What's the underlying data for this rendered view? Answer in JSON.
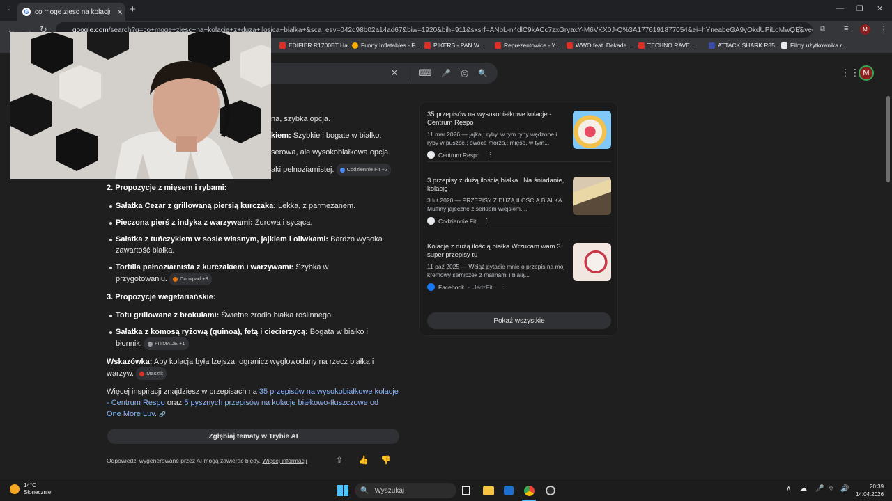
{
  "browser": {
    "tab_title": "co moge zjesc na kolacje z duż",
    "tab_close": "✕",
    "new_tab": "+",
    "url_host": "google.com",
    "url_rest": "/search?q=co+moge+zjesc+na+kolacje+z+duza+ilosica+bialka+&sca_esv=042d98b02a14ad67&biw=1920&bih=911&sxsrf=ANbL-n4dlC9kACc7zxGryaxY-M6VKX0J-Q%3A1776191877054&ei=hYneabeGA9yOkdUPiLqMwQE&ved=0ahU..."
  },
  "bookmarks": [
    {
      "label": "EDIFIER R1700BT Ha...",
      "color": "#d93025"
    },
    {
      "label": "Funny Inflatables - F...",
      "color": "#f9ab00"
    },
    {
      "label": "PIKERS - PAN W...",
      "color": "#d93025"
    },
    {
      "label": "Reprezentowice - Y...",
      "color": "#d93025"
    },
    {
      "label": "WWO feat. Dekade...",
      "color": "#d93025"
    },
    {
      "label": "TECHNO RAVE...",
      "color": "#d93025"
    },
    {
      "label": "ATTACK SHARK R85...",
      "color": "#3c4aa8"
    },
    {
      "label": "Filmy użytkownika r...",
      "color": "#e8eaed"
    }
  ],
  "overview": {
    "partial": [
      {
        "pre": "",
        "bold": "",
        "text": "na, szybka opcja."
      },
      {
        "pre": "",
        "bold": "kiem:",
        "text": " Szybkie i bogate w białko."
      },
      {
        "pre": "",
        "bold": "",
        "text": "serowa, ale wysokobiałkowa opcja."
      },
      {
        "pre": "",
        "bold": "",
        "text": "aki pełnoziarnistej."
      }
    ],
    "chip0": "Codziennie Fit +2",
    "section2": "2. Propozycje z mięsem i rybami:",
    "items2": [
      {
        "bold": "Sałatka Cezar z grillowaną piersią kurczaka:",
        "text": " Lekka, z parmezanem."
      },
      {
        "bold": "Pieczona pierś z indyka z warzywami:",
        "text": " Zdrowa i sycąca."
      },
      {
        "bold": "Sałatka z tuńczykiem w sosie własnym, jajkiem i oliwkami:",
        "text": " Bardzo wysoka",
        "line2": "zawartość białka."
      },
      {
        "bold": "Tortilla pełnoziarnista z kurczakiem i warzywami:",
        "text": " Szybka w",
        "line2": "przygotowaniu."
      }
    ],
    "chip1": "Cookpad +3",
    "section3": "3. Propozycje wegetariańskie:",
    "items3": [
      {
        "bold": "Tofu grillowane z brokułami:",
        "text": " Świetne źródło białka roślinnego."
      },
      {
        "bold": "Sałatka z komosą ryżową (quinoa), fetą i ciecierzycą:",
        "text": " Bogata w białko i",
        "line2": "błonnik."
      }
    ],
    "chip2": "FITMADE +1",
    "tip_bold": "Wskazówka:",
    "tip_text": " Aby kolacja była lżejsza, ogranicz węglowodany na rzecz białka i",
    "tip_line2": "warzyw.",
    "chip3": "Maczfit",
    "more_pre": "Więcej inspiracji znajdziesz w przepisach na ",
    "more_link1a": "35 przepisów na wysokobiałkowe kolacje",
    "more_link1b": "- Centrum Respo",
    "more_mid": " oraz ",
    "more_link2a": "5 pysznych przepisów na kolacje białkowo-tłuszczowe od",
    "more_link2b": "One More Luv",
    "more_end": ".",
    "dive_button": "Zgłębiaj tematy w Trybie AI",
    "disclaimer": "Odpowiedzi wygenerowane przez AI mogą zawierać błędy.",
    "disclaimer_link": "Więcej informacji"
  },
  "sources": [
    {
      "title": "35 przepisów na wysokobiałkowe kolacje - Centrum Respo",
      "snippet": "11 mar 2026 — jajka,; ryby, w tym ryby wędzone i ryby w puszce,; owoce morza,; mięso, w tym...",
      "site": "Centrum Respo",
      "site2": "",
      "icon_color": "#e8eaed"
    },
    {
      "title": "3 przepisy z dużą ilością białka | Na śniadanie, kolację",
      "snippet": "3 lut 2020 — PRZEPISY Z DUŻĄ ILOŚCIĄ BIAŁKA. Muffiny jajeczne z serkiem wiejskim....",
      "site": "Codziennie Fit",
      "site2": "",
      "icon_color": "#e8eaed"
    },
    {
      "title": "Kolacje z dużą ilością białka Wrzucam wam 3 super przepisy tu",
      "snippet": "11 paź 2025 — Wciąż pytacie mnie o przepis na mój kremowy serniczek z malinami i białą...",
      "site": "Facebook",
      "site2": "JedzFit",
      "icon_color": "#1877f2"
    }
  ],
  "show_all": "Pokaż wszystkie",
  "taskbar": {
    "weather_temp": "14°C",
    "weather_desc": "Słonecznie",
    "search_placeholder": "Wyszukaj",
    "time": "20:39",
    "date": "14.04.2026"
  },
  "icons": {
    "close": "✕",
    "keyboard": "⌨",
    "mic": "🎤",
    "lens": "◎",
    "search": "🔍",
    "apps": "⋮⋮",
    "avatar_letter": "M",
    "back": "←",
    "forward": "→",
    "reload": "↻",
    "star": "☆",
    "dots": "⋮",
    "share": "⇪",
    "thumbs_up": "👍",
    "thumbs_down": "👎"
  }
}
